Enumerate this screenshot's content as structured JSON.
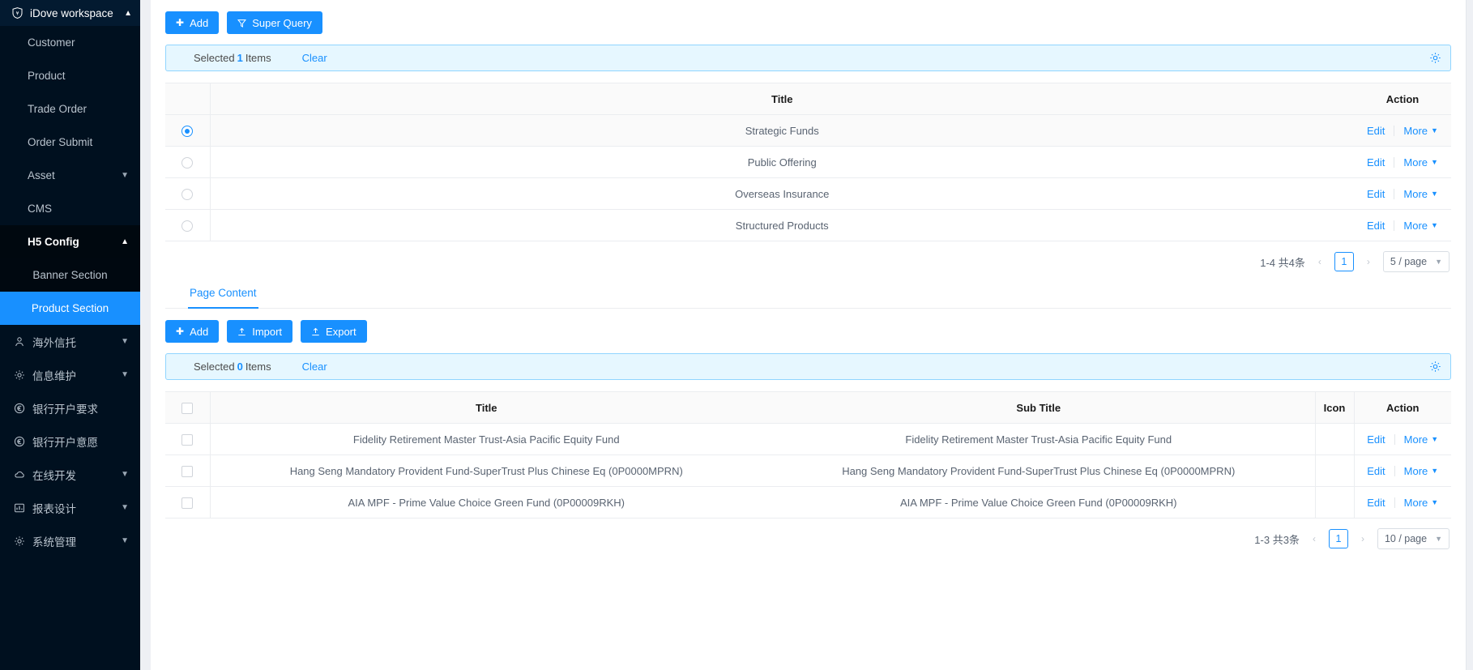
{
  "sidebar": {
    "workspace_title": "iDove workspace",
    "workspace_icon": "shield-logo-icon",
    "items": [
      {
        "label": "Customer",
        "icon": null,
        "expandable": false
      },
      {
        "label": "Product",
        "icon": null,
        "expandable": false
      },
      {
        "label": "Trade Order",
        "icon": null,
        "expandable": false
      },
      {
        "label": "Order Submit",
        "icon": null,
        "expandable": false
      },
      {
        "label": "Asset",
        "icon": null,
        "expandable": true
      },
      {
        "label": "CMS",
        "icon": null,
        "expandable": false
      },
      {
        "label": "H5 Config",
        "icon": null,
        "expandable": true,
        "open": true
      }
    ],
    "h5_children": [
      {
        "label": "Banner Section",
        "active": false
      },
      {
        "label": "Product Section",
        "active": true
      }
    ],
    "lower_items": [
      {
        "label": "海外信托",
        "icon": "users-icon",
        "expandable": true
      },
      {
        "label": "信息维护",
        "icon": "gear-icon",
        "expandable": true
      },
      {
        "label": "银行开户要求",
        "icon": "euro-circle-icon",
        "expandable": false
      },
      {
        "label": "银行开户意愿",
        "icon": "euro-circle-icon",
        "expandable": false
      },
      {
        "label": "在线开发",
        "icon": "cloud-icon",
        "expandable": true
      },
      {
        "label": "报表设计",
        "icon": "bar-chart-icon",
        "expandable": true
      },
      {
        "label": "系统管理",
        "icon": "gear-icon",
        "expandable": true
      }
    ]
  },
  "section_top": {
    "toolbar": [
      {
        "label": "Add",
        "icon": "plus-icon"
      },
      {
        "label": "Super Query",
        "icon": "filter-icon"
      }
    ],
    "alert": {
      "prefix": "Selected",
      "count": "1",
      "suffix": "Items",
      "clear_label": "Clear",
      "gear_icon": "gear-icon"
    },
    "columns": [
      "",
      "Title",
      "Action"
    ],
    "rows": [
      {
        "title": "Strategic Funds",
        "selected": true,
        "edit": "Edit",
        "more": "More"
      },
      {
        "title": "Public Offering",
        "selected": false,
        "edit": "Edit",
        "more": "More"
      },
      {
        "title": "Overseas Insurance",
        "selected": false,
        "edit": "Edit",
        "more": "More"
      },
      {
        "title": "Structured Products",
        "selected": false,
        "edit": "Edit",
        "more": "More"
      }
    ],
    "pagination": {
      "summary": "1-4 共4条",
      "prev": "‹",
      "page": "1",
      "next": "›",
      "page_size": "5 / page"
    }
  },
  "section_bottom": {
    "tabs": [
      {
        "label": "Page Content",
        "active": true
      }
    ],
    "toolbar": [
      {
        "label": "Add",
        "icon": "plus-icon"
      },
      {
        "label": "Import",
        "icon": "upload-icon"
      },
      {
        "label": "Export",
        "icon": "upload-icon"
      }
    ],
    "alert": {
      "prefix": "Selected",
      "count": "0",
      "suffix": "Items",
      "clear_label": "Clear",
      "gear_icon": "gear-icon"
    },
    "columns": [
      "",
      "Title",
      "Sub Title",
      "Icon",
      "Action"
    ],
    "rows": [
      {
        "title": "Fidelity Retirement Master Trust-Asia Pacific Equity Fund",
        "sub_title": "Fidelity Retirement Master Trust-Asia Pacific Equity Fund",
        "icon": "",
        "edit": "Edit",
        "more": "More"
      },
      {
        "title": "Hang Seng Mandatory Provident Fund-SuperTrust Plus Chinese Eq (0P0000MPRN)",
        "sub_title": "Hang Seng Mandatory Provident Fund-SuperTrust Plus Chinese Eq (0P0000MPRN)",
        "icon": "",
        "edit": "Edit",
        "more": "More"
      },
      {
        "title": "AIA MPF - Prime Value Choice Green Fund (0P00009RKH)",
        "sub_title": "AIA MPF - Prime Value Choice Green Fund (0P00009RKH)",
        "icon": "",
        "edit": "Edit",
        "more": "More"
      }
    ],
    "pagination": {
      "summary": "1-3 共3条",
      "prev": "‹",
      "page": "1",
      "next": "›",
      "page_size": "10 / page"
    }
  },
  "colors": {
    "primary": "#1890ff",
    "sidebar_bg": "#00101f",
    "alert_bg": "#e6f7ff",
    "alert_border": "#91d5ff"
  }
}
